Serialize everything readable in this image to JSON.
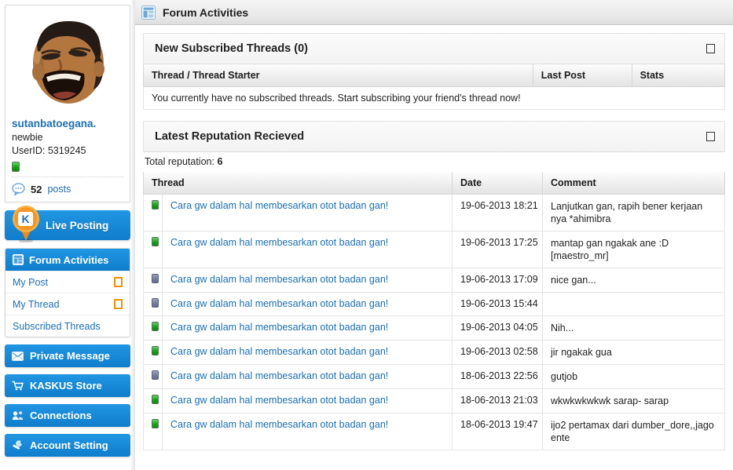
{
  "header": {
    "title": "Forum Activities",
    "icon": "layout-window-icon"
  },
  "sidebar": {
    "profile": {
      "avatar_icon": "user-avatar-photo",
      "username": "sutanbatoegana.",
      "usertitle": "newbie",
      "userid": "UserID: 5319245",
      "online_icon": "online-status-indicator",
      "posts_icon": "comment-bubble-icon",
      "posts_count": "52",
      "posts_label": "posts"
    },
    "live_posting": {
      "label": "Live Posting",
      "icon": "kaskus-pin-icon"
    },
    "forum_activities": {
      "label": "Forum Activities",
      "icon": "forum-activities-icon",
      "items": [
        {
          "label": "My Post",
          "badge_icon": "orange-box-glyph"
        },
        {
          "label": "My Thread",
          "badge_icon": "orange-box-glyph"
        },
        {
          "label": "Subscribed Threads",
          "badge_icon": ""
        }
      ]
    },
    "buttons": [
      {
        "label": "Private Message",
        "icon": "envelope-icon"
      },
      {
        "label": "KASKUS Store",
        "icon": "shopping-cart-icon"
      },
      {
        "label": "Connections",
        "icon": "connections-icon"
      },
      {
        "label": "Account Setting",
        "icon": "wrench-icon"
      }
    ]
  },
  "subscribed_panel": {
    "title": "New Subscribed Threads (0)",
    "collapse_icon": "collapse-box-glyph",
    "columns": [
      "Thread / Thread Starter",
      "Last Post",
      "Stats"
    ],
    "empty_message": "You currently have no subscribed threads. Start subscribing your friend's thread now!"
  },
  "reputation_panel": {
    "title": "Latest Reputation Recieved",
    "collapse_icon": "collapse-box-glyph",
    "total_label": "Total reputation:",
    "total_value": "6",
    "columns": [
      "Thread",
      "Date",
      "Comment"
    ],
    "rows": [
      {
        "dot": "green",
        "thread": "Cara gw dalam hal membesarkan otot badan gan!",
        "date": "19-06-2013 18:21",
        "comment": "Lanjutkan gan, rapih bener kerjaan nya *ahimibra"
      },
      {
        "dot": "green",
        "thread": "Cara gw dalam hal membesarkan otot badan gan!",
        "date": "19-06-2013 17:25",
        "comment": "mantap gan ngakak ane :D [maestro_mr]"
      },
      {
        "dot": "gray",
        "thread": "Cara gw dalam hal membesarkan otot badan gan!",
        "date": "19-06-2013 17:09",
        "comment": "nice gan..."
      },
      {
        "dot": "gray",
        "thread": "Cara gw dalam hal membesarkan otot badan gan!",
        "date": "19-06-2013 15:44",
        "comment": ""
      },
      {
        "dot": "green",
        "thread": "Cara gw dalam hal membesarkan otot badan gan!",
        "date": "19-06-2013 04:05",
        "comment": "Nih..."
      },
      {
        "dot": "green",
        "thread": "Cara gw dalam hal membesarkan otot badan gan!",
        "date": "19-06-2013 02:58",
        "comment": "jir ngakak gua"
      },
      {
        "dot": "gray",
        "thread": "Cara gw dalam hal membesarkan otot badan gan!",
        "date": "18-06-2013 22:56",
        "comment": "gutjob"
      },
      {
        "dot": "green",
        "thread": "Cara gw dalam hal membesarkan otot badan gan!",
        "date": "18-06-2013 21:03",
        "comment": "wkwkwkwkwk sarap- sarap"
      },
      {
        "dot": "green",
        "thread": "Cara gw dalam hal membesarkan otot badan gan!",
        "date": "18-06-2013 19:47",
        "comment": "ijo2 pertamax dari dumber_dore,,jago ente"
      }
    ]
  },
  "colors": {
    "accent_blue": "#0f7dcb",
    "link_blue": "#1a6fb5",
    "orange": "#f39200",
    "rep_green": "#16a316",
    "rep_gray": "#767c9e"
  }
}
